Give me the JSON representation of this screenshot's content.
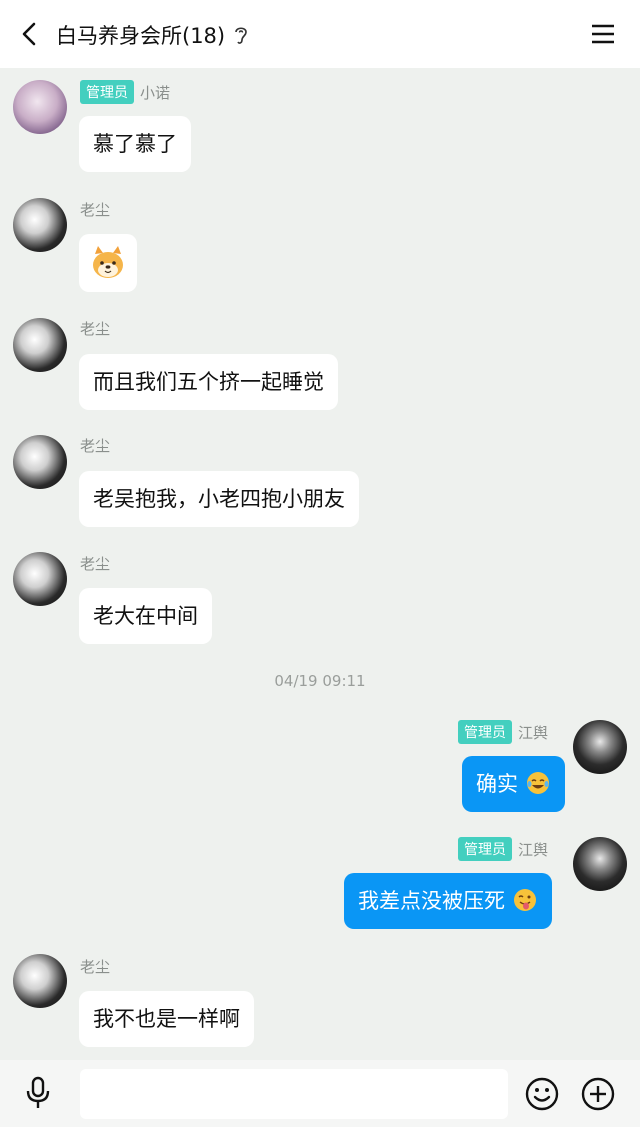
{
  "header": {
    "title": "白马养身会所(18)"
  },
  "messages": [
    {
      "sender": "小诺",
      "badge": "管理员",
      "text": "慕了慕了",
      "side": "left"
    },
    {
      "sender": "老尘",
      "text": "",
      "emoji": "dog-face-emoji",
      "side": "left"
    },
    {
      "sender": "老尘",
      "text": "而且我们五个挤一起睡觉",
      "side": "left"
    },
    {
      "sender": "老尘",
      "text": "老吴抱我，小老四抱小朋友",
      "side": "left"
    },
    {
      "sender": "老尘",
      "text": "老大在中间",
      "side": "left"
    },
    {
      "sender": "江舆",
      "badge": "管理员",
      "text": "确实",
      "emoji": "laughing-tears-emoji",
      "side": "right"
    },
    {
      "sender": "江舆",
      "badge": "管理员",
      "text": "我差点没被压死",
      "emoji": "tongue-out-emoji",
      "side": "right"
    },
    {
      "sender": "老尘",
      "text": "我不也是一样啊",
      "side": "left"
    }
  ],
  "timestamp": "04/19 09:11",
  "footer": {
    "input_value": ""
  },
  "colors": {
    "accent": "#0a96f5",
    "badge": "#43cfbf",
    "background": "#eef1ee"
  },
  "icons": [
    "back-arrow-icon",
    "ear-icon",
    "menu-icon",
    "microphone-icon",
    "emoji-icon",
    "plus-icon"
  ]
}
